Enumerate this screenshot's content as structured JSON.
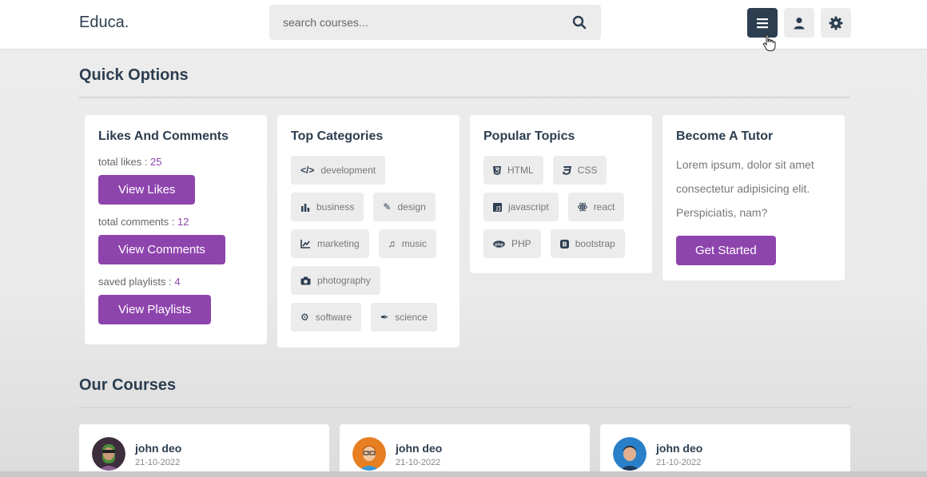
{
  "header": {
    "logo": "Educa.",
    "search_placeholder": "search courses...",
    "icons": [
      "search-icon",
      "menu-icon",
      "user-icon",
      "gear-icon"
    ]
  },
  "quick_options": {
    "title": "Quick Options",
    "likes_card": {
      "title": "Likes And Comments",
      "likes_label": "total likes : ",
      "likes_value": "25",
      "likes_button": "View Likes",
      "comments_label": "total comments : ",
      "comments_value": "12",
      "comments_button": "View Comments",
      "playlists_label": "saved playlists : ",
      "playlists_value": "4",
      "playlists_button": "View Playlists"
    },
    "categories_card": {
      "title": "Top Categories",
      "items": [
        {
          "label": "development",
          "icon": "code-icon"
        },
        {
          "label": "business",
          "icon": "chart-bar-icon"
        },
        {
          "label": "design",
          "icon": "pen-icon"
        },
        {
          "label": "marketing",
          "icon": "chart-line-icon"
        },
        {
          "label": "music",
          "icon": "music-icon"
        },
        {
          "label": "photography",
          "icon": "camera-icon"
        },
        {
          "label": "software",
          "icon": "cog-icon"
        },
        {
          "label": "science",
          "icon": "vial-icon"
        }
      ]
    },
    "topics_card": {
      "title": "Popular Topics",
      "items": [
        {
          "label": "HTML",
          "icon": "html5-icon"
        },
        {
          "label": "CSS",
          "icon": "css3-icon"
        },
        {
          "label": "javascript",
          "icon": "js-icon"
        },
        {
          "label": "react",
          "icon": "react-icon"
        },
        {
          "label": "PHP",
          "icon": "php-icon"
        },
        {
          "label": "bootstrap",
          "icon": "bootstrap-icon"
        }
      ]
    },
    "tutor_card": {
      "title": "Become A Tutor",
      "text": "Lorem ipsum, dolor sit amet consectetur adipisicing elit. Perspiciatis, nam?",
      "button": "Get Started"
    }
  },
  "courses": {
    "title": "Our Courses",
    "items": [
      {
        "name": "john deo",
        "date": "21-10-2022"
      },
      {
        "name": "john deo",
        "date": "21-10-2022"
      },
      {
        "name": "john deo",
        "date": "21-10-2022"
      }
    ]
  },
  "colors": {
    "accent": "#8e44ad",
    "dark": "#2c3e50",
    "light": "#ececec"
  }
}
